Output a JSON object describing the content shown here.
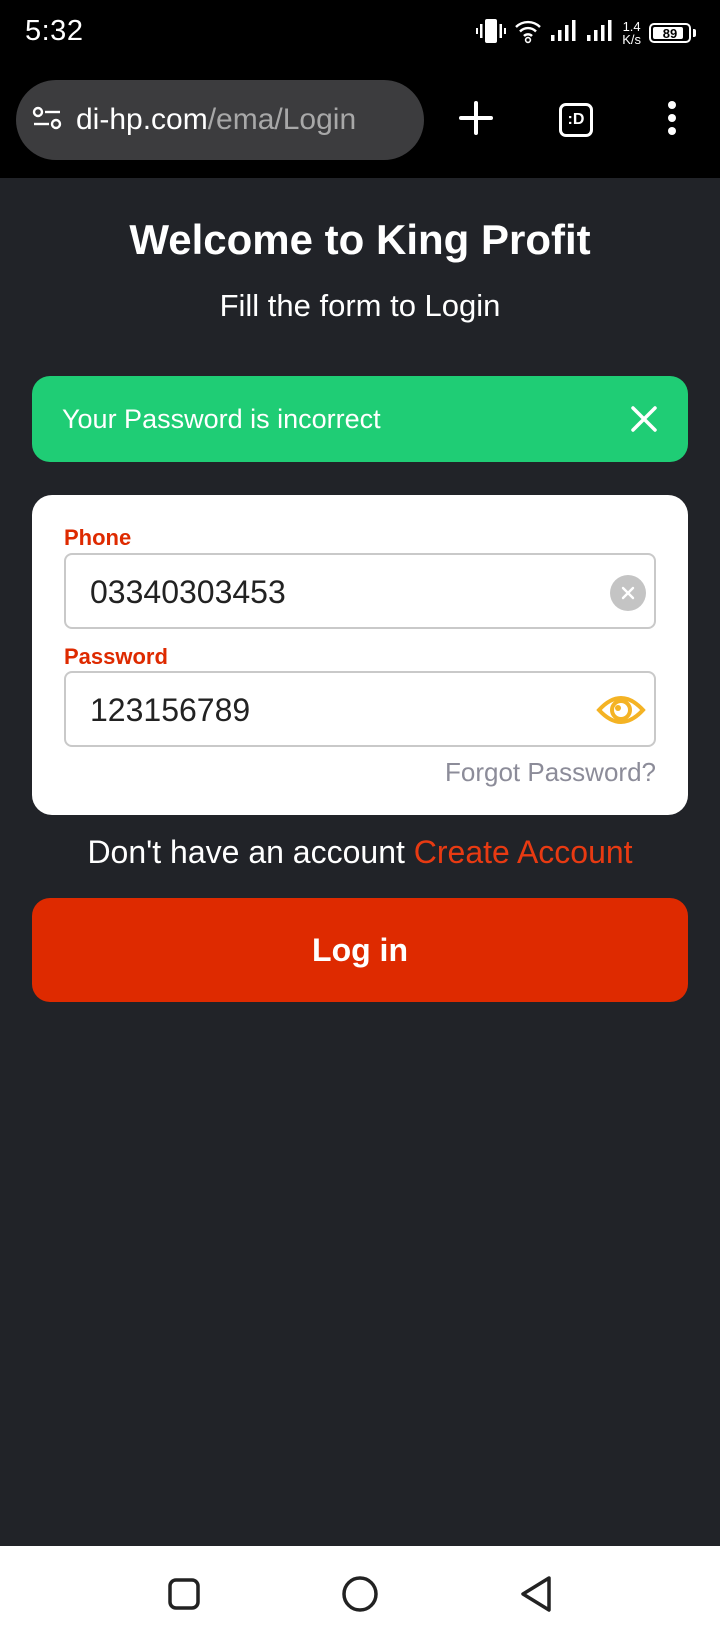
{
  "status_bar": {
    "time": "5:32",
    "net_speed_value": "1.4",
    "net_speed_unit": "K/s",
    "battery": "89",
    "battery_level": 0.89,
    "icons": [
      "vibrate-icon",
      "wifi-icon",
      "signal-icon",
      "signal-icon"
    ]
  },
  "browser": {
    "url_host": "di-hp.com",
    "url_path": "/ema/Login",
    "tab_label": ":D",
    "icons": [
      "site-settings-icon",
      "new-tab-icon",
      "menu-icon"
    ]
  },
  "page": {
    "title": "Welcome to King Profit",
    "subtitle": "Fill the form to Login"
  },
  "alert": {
    "message": "Your Password is incorrect",
    "color": "#1fcd75"
  },
  "form": {
    "phone_label": "Phone",
    "phone_value": "03340303453",
    "password_label": "Password",
    "password_value": "123156789",
    "forgot_label": "Forgot Password?"
  },
  "signup": {
    "prompt": "Don't have an account",
    "link": "Create Account"
  },
  "login_button": {
    "label": "Log in",
    "color": "#de2a00"
  },
  "nav_bar": {
    "icons": [
      "recents-icon",
      "home-icon",
      "back-icon"
    ]
  }
}
